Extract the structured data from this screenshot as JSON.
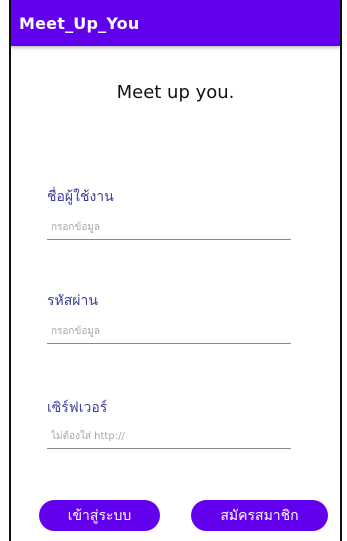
{
  "appbar": {
    "title": "Meet_Up_You",
    "color": "#6200ee"
  },
  "headline": "Meet up you.",
  "form": {
    "username": {
      "label": "ชื่อผู้ใช้งาน",
      "placeholder": "กรอกข้อมูล",
      "value": ""
    },
    "password": {
      "label": "รหัสผ่าน",
      "placeholder": "กรอกข้อมูล",
      "value": ""
    },
    "server": {
      "label": "เซิร์ฟเวอร์",
      "placeholder": "ไม่ต้องใส่ http://",
      "value": ""
    }
  },
  "buttons": {
    "login": "เข้าสู่ระบบ",
    "signup": "สมัครสมาชิก"
  }
}
